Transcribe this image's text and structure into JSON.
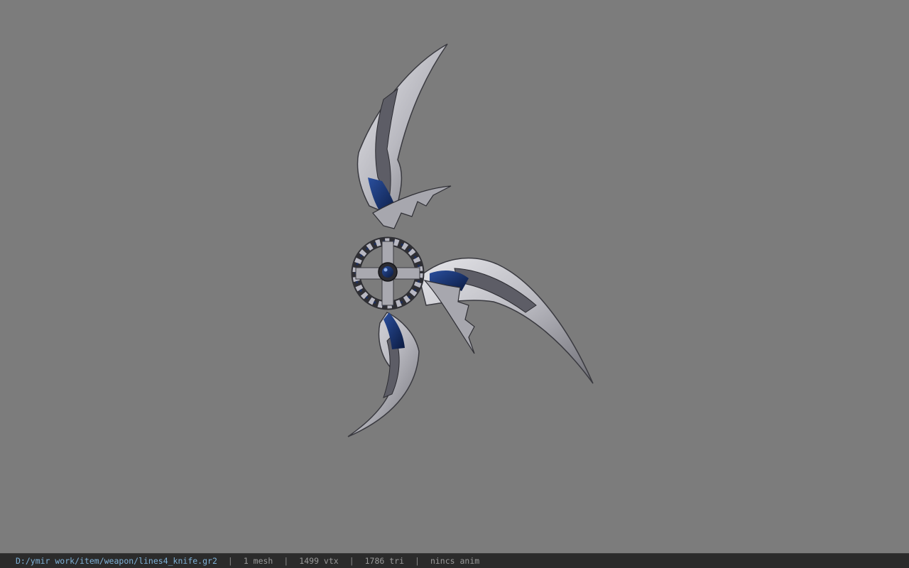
{
  "viewport": {
    "background": "#7c7c7c",
    "model": {
      "icon": "four-bladed-throwing-knife",
      "accent_color": "#1d3a7a",
      "metal_color": "#c9c9cf"
    }
  },
  "statusbar": {
    "file_path": "D:/ymir work/item/weapon/lines4_knife.gr2",
    "mesh_count": "1 mesh",
    "vertex_count": "1499 vtx",
    "triangle_count": "1786 tri",
    "animation": "nincs anim",
    "separator": "|"
  }
}
